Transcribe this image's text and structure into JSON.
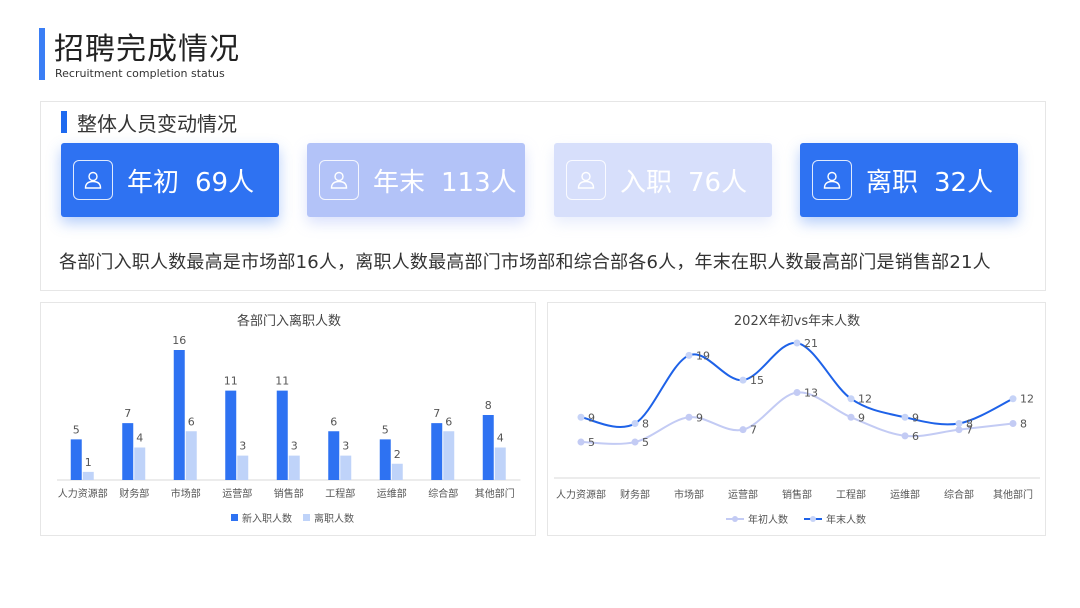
{
  "header": {
    "title": "招聘完成情况",
    "subtitle": "Recruitment completion status"
  },
  "overview": {
    "section_title": "整体人员变动情况",
    "cards": [
      {
        "label": "年初",
        "value": "69人"
      },
      {
        "label": "年末",
        "value": "113人"
      },
      {
        "label": "入职",
        "value": "76人"
      },
      {
        "label": "离职",
        "value": "32人"
      }
    ],
    "summary": "各部门入职人数最高是市场部16人，离职人数最高部门市场部和综合部各6人，年末在职人数最高部门是销售部21人"
  },
  "colors": {
    "accent": "#2e72f2",
    "bar_new": "#2e72f2",
    "bar_leave": "#bfd3f9",
    "line_start": "#c3cbf4",
    "line_end": "#1e62e8"
  },
  "chart_data": [
    {
      "type": "bar",
      "title": "各部门入离职人数",
      "categories": [
        "人力资源部",
        "财务部",
        "市场部",
        "运营部",
        "销售部",
        "工程部",
        "运维部",
        "综合部",
        "其他部门"
      ],
      "series": [
        {
          "name": "新入职人数",
          "values": [
            5,
            7,
            16,
            11,
            11,
            6,
            5,
            7,
            8
          ]
        },
        {
          "name": "离职人数",
          "values": [
            1,
            4,
            6,
            3,
            3,
            3,
            2,
            6,
            4
          ]
        }
      ],
      "ylim": [
        0,
        16
      ],
      "grid": false,
      "legend": "bottom"
    },
    {
      "type": "line",
      "title": "202X年初vs年末人数",
      "categories": [
        "人力资源部",
        "财务部",
        "市场部",
        "运营部",
        "销售部",
        "工程部",
        "运维部",
        "综合部",
        "其他部门"
      ],
      "series": [
        {
          "name": "年初人数",
          "values": [
            5,
            5,
            9,
            7,
            13,
            9,
            6,
            7,
            8
          ]
        },
        {
          "name": "年末人数",
          "values": [
            9,
            8,
            19,
            15,
            21,
            12,
            9,
            8,
            12
          ]
        }
      ],
      "ylim": [
        0,
        21
      ],
      "grid": false,
      "legend": "bottom"
    }
  ]
}
